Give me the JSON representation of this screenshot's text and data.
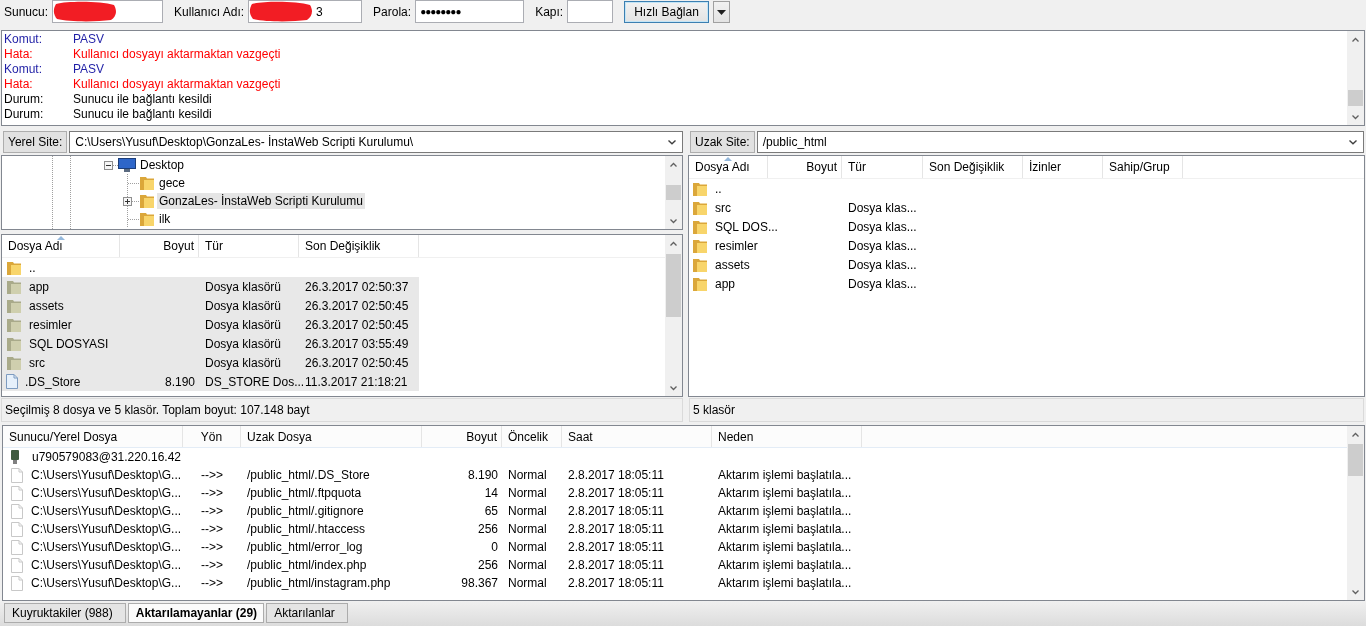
{
  "quickconnect": {
    "fields": [
      {
        "label": "Sunucu:",
        "kind": "text",
        "redacted": true
      },
      {
        "label": "Kullanıcı Adı:",
        "kind": "text",
        "redacted": true,
        "value": "3"
      },
      {
        "label": "Parola:",
        "kind": "password",
        "redacted": false,
        "value": "●●●●●●●●"
      },
      {
        "label": "Kapı:",
        "kind": "text",
        "redacted": false
      }
    ],
    "button": "Hızlı Bağlan"
  },
  "message_log": [
    {
      "kind": "command",
      "label": "Komut:",
      "text": "PASV"
    },
    {
      "kind": "error",
      "label": "Hata:",
      "text": "Kullanıcı dosyayı aktarmaktan vazgeçti"
    },
    {
      "kind": "command",
      "label": "Komut:",
      "text": "PASV"
    },
    {
      "kind": "error",
      "label": "Hata:",
      "text": "Kullanıcı dosyayı aktarmaktan vazgeçti"
    },
    {
      "kind": "status",
      "label": "Durum:",
      "text": "Sunucu ile bağlantı kesildi"
    },
    {
      "kind": "status",
      "label": "Durum:",
      "text": "Sunucu ile bağlantı kesildi"
    }
  ],
  "local_site": {
    "label": "Yerel Site:",
    "path": "C:\\Users\\Yusuf\\Desktop\\GonzaLes- İnstaWeb Scripti Kurulumu\\"
  },
  "local_tree": [
    {
      "name": "Desktop",
      "kind": "desktop",
      "expanded": true,
      "selected": false,
      "children": [
        {
          "name": "gece",
          "kind": "folder",
          "selected": false
        },
        {
          "name": "GonzaLes- İnstaWeb Scripti Kurulumu",
          "kind": "folder",
          "expanded": false,
          "selected": true
        },
        {
          "name": "ilk",
          "kind": "folder",
          "selected": false
        }
      ]
    }
  ],
  "local_files": {
    "columns": [
      {
        "label": "Dosya Adı",
        "sorted": true
      },
      {
        "label": "Boyut",
        "sorted": false
      },
      {
        "label": "Tür",
        "sorted": false
      },
      {
        "label": "Son Değişiklik",
        "sorted": false
      }
    ],
    "rows": [
      {
        "kind": "folder",
        "name": "..",
        "selected": false
      },
      {
        "kind": "folder",
        "name": "app",
        "type": "Dosya klasörü",
        "modified": "26.3.2017 02:50:37",
        "selected": true
      },
      {
        "kind": "folder",
        "name": "assets",
        "type": "Dosya klasörü",
        "modified": "26.3.2017 02:50:45",
        "selected": true
      },
      {
        "kind": "folder",
        "name": "resimler",
        "type": "Dosya klasörü",
        "modified": "26.3.2017 02:50:45",
        "selected": true
      },
      {
        "kind": "folder",
        "name": "SQL DOSYASI",
        "type": "Dosya klasörü",
        "modified": "26.3.2017 03:55:49",
        "selected": true
      },
      {
        "kind": "folder",
        "name": "src",
        "type": "Dosya klasörü",
        "modified": "26.3.2017 02:50:45",
        "selected": true
      },
      {
        "kind": "file",
        "name": ".DS_Store",
        "size": "8.190",
        "type": "DS_STORE Dos...",
        "modified": "11.3.2017 21:18:21",
        "selected": true
      }
    ],
    "status": "Seçilmiş 8 dosya ve 5 klasör. Toplam boyut: 107.148 bayt"
  },
  "remote_site": {
    "label": "Uzak Site:",
    "path": "/public_html"
  },
  "remote_files": {
    "columns": [
      {
        "label": "Dosya Adı",
        "sorted": true
      },
      {
        "label": "Boyut",
        "sorted": false
      },
      {
        "label": "Tür",
        "sorted": false
      },
      {
        "label": "Son Değişiklik",
        "sorted": false
      },
      {
        "label": "İzinler",
        "sorted": false
      },
      {
        "label": "Sahip/Grup",
        "sorted": false
      }
    ],
    "rows": [
      {
        "kind": "folder",
        "name": ".."
      },
      {
        "kind": "folder",
        "name": "src",
        "type": "Dosya klas..."
      },
      {
        "kind": "folder",
        "name": "SQL DOS...",
        "type": "Dosya klas..."
      },
      {
        "kind": "folder",
        "name": "resimler",
        "type": "Dosya klas..."
      },
      {
        "kind": "folder",
        "name": "assets",
        "type": "Dosya klas..."
      },
      {
        "kind": "folder",
        "name": "app",
        "type": "Dosya klas..."
      }
    ],
    "status": "5 klasör"
  },
  "queue": {
    "columns": [
      "Sunucu/Yerel Dosya",
      "Yön",
      "Uzak Dosya",
      "Boyut",
      "Öncelik",
      "Saat",
      "Neden"
    ],
    "server": "u790579083@31.220.16.42",
    "items": [
      {
        "local": "C:\\Users\\Yusuf\\Desktop\\G...",
        "direction": "-->>",
        "remote": "/public_html/.DS_Store",
        "size": "8.190",
        "priority": "Normal",
        "time": "2.8.2017 18:05:11",
        "reason": "Aktarım işlemi başlatıla..."
      },
      {
        "local": "C:\\Users\\Yusuf\\Desktop\\G...",
        "direction": "-->>",
        "remote": "/public_html/.ftpquota",
        "size": "14",
        "priority": "Normal",
        "time": "2.8.2017 18:05:11",
        "reason": "Aktarım işlemi başlatıla..."
      },
      {
        "local": "C:\\Users\\Yusuf\\Desktop\\G...",
        "direction": "-->>",
        "remote": "/public_html/.gitignore",
        "size": "65",
        "priority": "Normal",
        "time": "2.8.2017 18:05:11",
        "reason": "Aktarım işlemi başlatıla..."
      },
      {
        "local": "C:\\Users\\Yusuf\\Desktop\\G...",
        "direction": "-->>",
        "remote": "/public_html/.htaccess",
        "size": "256",
        "priority": "Normal",
        "time": "2.8.2017 18:05:11",
        "reason": "Aktarım işlemi başlatıla..."
      },
      {
        "local": "C:\\Users\\Yusuf\\Desktop\\G...",
        "direction": "-->>",
        "remote": "/public_html/error_log",
        "size": "0",
        "priority": "Normal",
        "time": "2.8.2017 18:05:11",
        "reason": "Aktarım işlemi başlatıla..."
      },
      {
        "local": "C:\\Users\\Yusuf\\Desktop\\G...",
        "direction": "-->>",
        "remote": "/public_html/index.php",
        "size": "256",
        "priority": "Normal",
        "time": "2.8.2017 18:05:11",
        "reason": "Aktarım işlemi başlatıla..."
      },
      {
        "local": "C:\\Users\\Yusuf\\Desktop\\G...",
        "direction": "-->>",
        "remote": "/public_html/instagram.php",
        "size": "98.367",
        "priority": "Normal",
        "time": "2.8.2017 18:05:11",
        "reason": "Aktarım işlemi başlatıla..."
      }
    ]
  },
  "tabs": [
    {
      "label": "Kuyruktakiler (988)",
      "selected": false
    },
    {
      "label": "Aktarılamayanlar (29)",
      "selected": true
    },
    {
      "label": "Aktarılanlar",
      "selected": false
    }
  ]
}
